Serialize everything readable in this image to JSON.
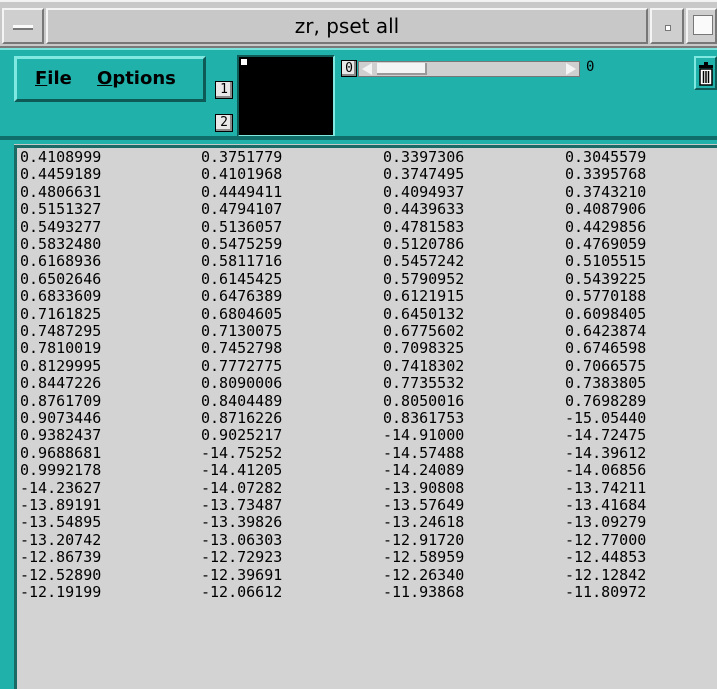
{
  "window": {
    "title": "zr, pset all"
  },
  "menu": {
    "file_label": "File",
    "file_mnemonic": "F",
    "file_rest": "ile",
    "options_label": "Options",
    "options_mnemonic": "O",
    "options_rest": "ptions"
  },
  "toolbar": {
    "button1_label": "1",
    "button2_label": "2",
    "slider_value": "0",
    "slider_max": "0"
  },
  "colors": {
    "toolbar_bg": "#20b2aa",
    "data_bg": "#d3d3d3",
    "frame_bg": "#c8c8c8"
  },
  "icons": {
    "window_menu": "window-menu-icon",
    "minimize": "minimize-icon",
    "maximize": "maximize-icon",
    "trash": "trash-icon"
  },
  "table": {
    "rows": [
      [
        "0.4108999",
        "0.3751779",
        "0.3397306",
        "0.3045579"
      ],
      [
        "0.4459189",
        "0.4101968",
        "0.3747495",
        "0.3395768"
      ],
      [
        "0.4806631",
        "0.4449411",
        "0.4094937",
        "0.3743210"
      ],
      [
        "0.5151327",
        "0.4794107",
        "0.4439633",
        "0.4087906"
      ],
      [
        "0.5493277",
        "0.5136057",
        "0.4781583",
        "0.4429856"
      ],
      [
        "0.5832480",
        "0.5475259",
        "0.5120786",
        "0.4769059"
      ],
      [
        "0.6168936",
        "0.5811716",
        "0.5457242",
        "0.5105515"
      ],
      [
        "0.6502646",
        "0.6145425",
        "0.5790952",
        "0.5439225"
      ],
      [
        "0.6833609",
        "0.6476389",
        "0.6121915",
        "0.5770188"
      ],
      [
        "0.7161825",
        "0.6804605",
        "0.6450132",
        "0.6098405"
      ],
      [
        "0.7487295",
        "0.7130075",
        "0.6775602",
        "0.6423874"
      ],
      [
        "0.7810019",
        "0.7452798",
        "0.7098325",
        "0.6746598"
      ],
      [
        "0.8129995",
        "0.7772775",
        "0.7418302",
        "0.7066575"
      ],
      [
        "0.8447226",
        "0.8090006",
        "0.7735532",
        "0.7383805"
      ],
      [
        "0.8761709",
        "0.8404489",
        "0.8050016",
        "0.7698289"
      ],
      [
        "0.9073446",
        "0.8716226",
        "0.8361753",
        "-15.05440"
      ],
      [
        "0.9382437",
        "0.9025217",
        "-14.91000",
        "-14.72475"
      ],
      [
        "0.9688681",
        "-14.75252",
        "-14.57488",
        "-14.39612"
      ],
      [
        "0.9992178",
        "-14.41205",
        "-14.24089",
        "-14.06856"
      ],
      [
        "-14.23627",
        "-14.07282",
        "-13.90808",
        "-13.74211"
      ],
      [
        "-13.89191",
        "-13.73487",
        "-13.57649",
        "-13.41684"
      ],
      [
        "-13.54895",
        "-13.39826",
        "-13.24618",
        "-13.09279"
      ],
      [
        "-13.20742",
        "-13.06303",
        "-12.91720",
        "-12.77000"
      ],
      [
        "-12.86739",
        "-12.72923",
        "-12.58959",
        "-12.44853"
      ],
      [
        "-12.52890",
        "-12.39691",
        "-12.26340",
        "-12.12842"
      ],
      [
        "-12.19199",
        "-12.06612",
        "-11.93868",
        "-11.80972"
      ]
    ]
  }
}
